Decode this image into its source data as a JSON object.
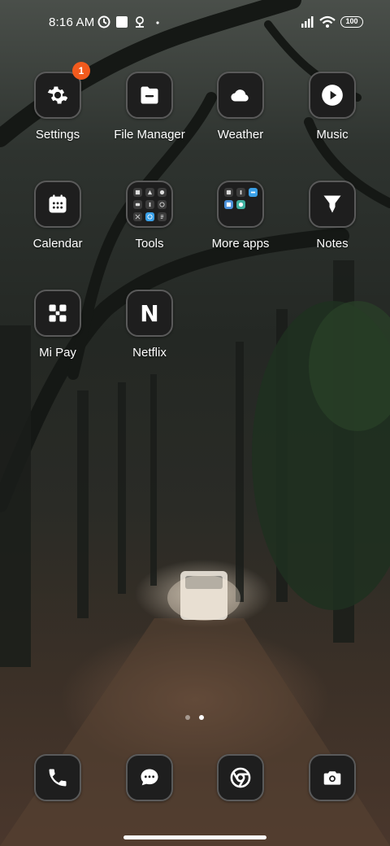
{
  "status": {
    "time": "8:16 AM",
    "battery": "100",
    "icons": [
      "clock-icon",
      "square-notification-icon",
      "location-icon",
      "dot-icon",
      "signal-icon",
      "wifi-icon",
      "battery-icon"
    ]
  },
  "apps": [
    {
      "name": "Settings",
      "icon": "gear-icon",
      "badge": "1"
    },
    {
      "name": "File Manager",
      "icon": "folder-icon"
    },
    {
      "name": "Weather",
      "icon": "cloud-icon"
    },
    {
      "name": "Music",
      "icon": "play-icon"
    },
    {
      "name": "Calendar",
      "icon": "calendar-icon"
    },
    {
      "name": "Tools",
      "icon": "folder-tools-icon"
    },
    {
      "name": "More apps",
      "icon": "folder-more-apps-icon"
    },
    {
      "name": "Notes",
      "icon": "notes-icon"
    },
    {
      "name": "Mi Pay",
      "icon": "mi-pay-icon"
    },
    {
      "name": "Netflix",
      "icon": "netflix-icon",
      "glyph": "N"
    }
  ],
  "dock": [
    {
      "name": "Phone",
      "icon": "phone-icon"
    },
    {
      "name": "Messages",
      "icon": "message-icon"
    },
    {
      "name": "Chrome",
      "icon": "chrome-icon"
    },
    {
      "name": "Camera",
      "icon": "camera-icon"
    }
  ],
  "page_indicator": {
    "pages": 2,
    "current": 2
  },
  "colors": {
    "badge": "#f25a1d",
    "tile_bg": "#1e1e1e",
    "tile_border": "#5a5a5a",
    "accent_blue": "#3aa0e8"
  }
}
